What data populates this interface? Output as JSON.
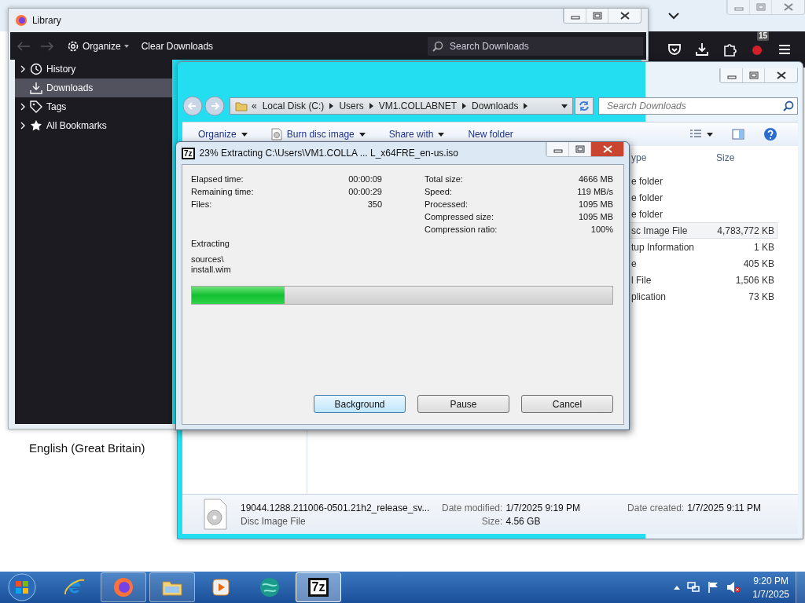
{
  "browser": {
    "toolbar": [
      {
        "kind": "pocket"
      },
      {
        "kind": "download"
      },
      {
        "kind": "extensions"
      },
      {
        "kind": "addon",
        "badge": "15"
      },
      {
        "kind": "menu"
      }
    ],
    "language": "English (Great Britain)"
  },
  "library": {
    "title": "Library",
    "organize": "Organize",
    "clear": "Clear Downloads",
    "search_placeholder": "Search Downloads",
    "sidebar": [
      {
        "label": "History",
        "kind": "clock",
        "expandable": true,
        "selected": false
      },
      {
        "label": "Downloads",
        "kind": "download",
        "expandable": false,
        "selected": true
      },
      {
        "label": "Tags",
        "kind": "tag",
        "expandable": true,
        "selected": false
      },
      {
        "label": "All Bookmarks",
        "kind": "star",
        "expandable": true,
        "selected": false
      }
    ]
  },
  "explorer": {
    "breadcrumb_overflow": "«",
    "breadcrumb": [
      "Local Disk (C:)",
      "Users",
      "VM1.COLLABNET",
      "Downloads"
    ],
    "search_placeholder": "Search Downloads",
    "toolbar": [
      {
        "label": "Organize",
        "dropdown": true,
        "kind": "plain"
      },
      {
        "label": "Burn disc image",
        "dropdown": true,
        "kind": "disc"
      },
      {
        "label": "Share with",
        "dropdown": true,
        "kind": "plain"
      },
      {
        "label": "New folder",
        "dropdown": false,
        "kind": "plain"
      }
    ],
    "columns": [
      "ype",
      "Size"
    ],
    "rows": [
      {
        "type": "e folder",
        "selected": false
      },
      {
        "type": "e folder",
        "selected": false
      },
      {
        "type": "e folder",
        "selected": false
      },
      {
        "type": "sc Image File",
        "size": "4,783,772 KB",
        "selected": true
      },
      {
        "type": "tup Information",
        "size": "1 KB",
        "selected": false
      },
      {
        "type": "e",
        "size": "405 KB",
        "selected": false
      },
      {
        "type": "l File",
        "size": "1,506 KB",
        "selected": false
      },
      {
        "type": "plication",
        "size": "73 KB",
        "selected": false
      }
    ],
    "details": {
      "name": "19044.1288.211006-0501.21h2_release_sv...",
      "type": "Disc Image File",
      "modified_label": "Date modified:",
      "modified": "1/7/2025 9:19 PM",
      "size_label": "Size:",
      "size": "4.56 GB",
      "created_label": "Date created:",
      "created": "1/7/2025 9:11 PM"
    }
  },
  "dialog": {
    "icon_label": "7z",
    "title": "23% Extracting C:\\Users\\VM1.COLLA ... L_x64FRE_en-us.iso",
    "left_stats": [
      {
        "label": "Elapsed time:",
        "value": "00:00:09"
      },
      {
        "label": "Remaining time:",
        "value": "00:00:29"
      },
      {
        "label": "Files:",
        "value": "350"
      }
    ],
    "right_stats": [
      {
        "label": "Total size:",
        "value": "4666 MB"
      },
      {
        "label": "Speed:",
        "value": "119 MB/s"
      },
      {
        "label": "Processed:",
        "value": "1095 MB"
      },
      {
        "label": "Compressed size:",
        "value": "1095 MB"
      },
      {
        "label": "Compression ratio:",
        "value": "100%"
      }
    ],
    "status": "Extracting",
    "path_lines": [
      "sources\\",
      "install.wim"
    ],
    "progress": {
      "level": 0.22
    },
    "buttons": [
      {
        "label": "Background",
        "focused": true
      },
      {
        "label": "Pause",
        "focused": false
      },
      {
        "label": "Cancel",
        "focused": false
      }
    ]
  },
  "taskbar": {
    "apps": [
      {
        "kind": "ie",
        "running": false,
        "selected": false
      },
      {
        "kind": "firefox",
        "running": true,
        "selected": false
      },
      {
        "kind": "folder",
        "running": true,
        "selected": false
      },
      {
        "kind": "media",
        "running": false,
        "selected": false
      },
      {
        "kind": "globe",
        "running": false,
        "selected": false
      },
      {
        "kind": "sevenzip",
        "label": "7z",
        "running": true,
        "selected": true
      }
    ],
    "clock": {
      "time": "9:20 PM",
      "date": "1/7/2025"
    }
  }
}
